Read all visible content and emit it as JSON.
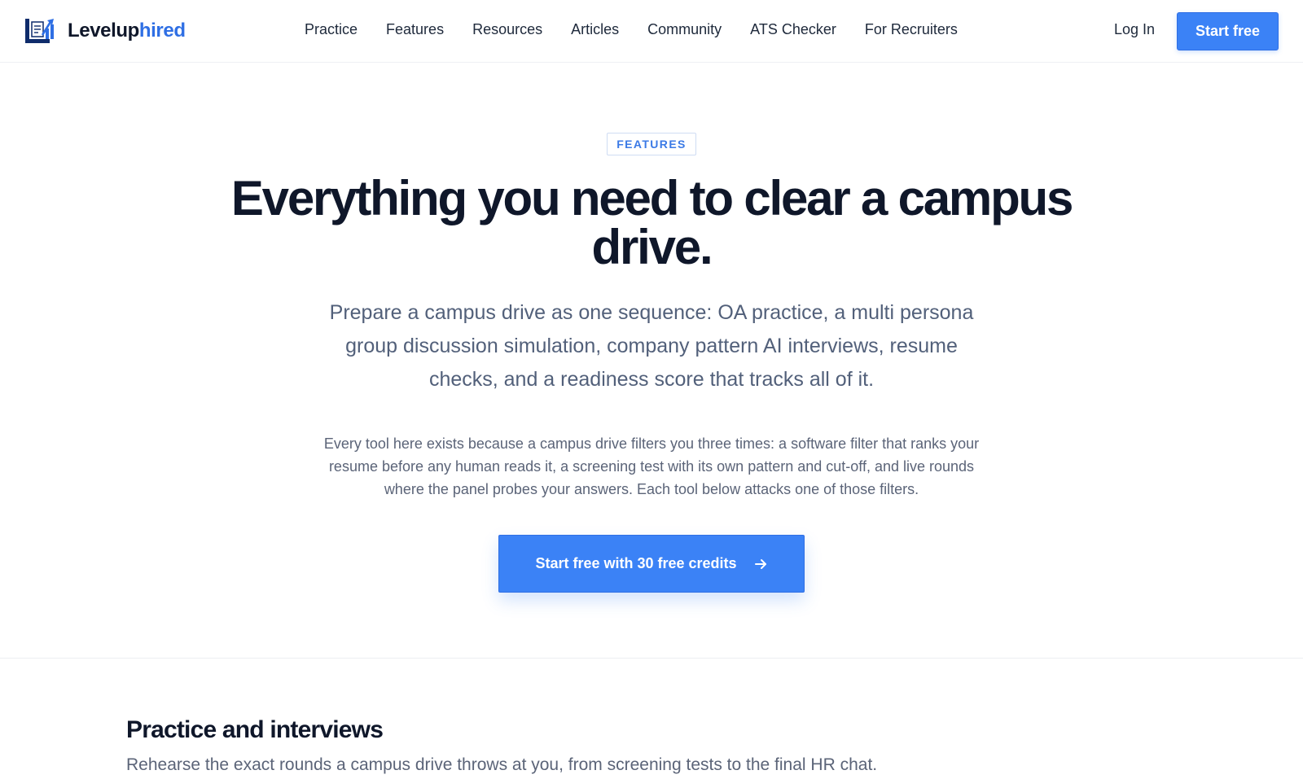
{
  "header": {
    "logo": {
      "name_part1": "Levelup",
      "name_part2": "hired",
      "icon": "chart-document-logo-icon"
    },
    "nav": [
      {
        "label": "Practice"
      },
      {
        "label": "Features"
      },
      {
        "label": "Resources"
      },
      {
        "label": "Articles"
      },
      {
        "label": "Community"
      },
      {
        "label": "ATS Checker"
      },
      {
        "label": "For Recruiters"
      }
    ],
    "login_label": "Log In",
    "start_label": "Start free"
  },
  "hero": {
    "badge": "FEATURES",
    "title_line1": "Everything you need to clear a campus",
    "title_line2": "drive.",
    "subtitle_line1": "Prepare a campus drive as one sequence: OA practice, a multi persona",
    "subtitle_line2": "group discussion simulation, company pattern AI interviews, resume",
    "subtitle_line3": "checks, and a readiness score that tracks all of it.",
    "body_line1": "Every tool here exists because a campus drive filters you three times: a software filter that ranks your",
    "body_line2": "resume before any human reads it, a screening test with its own pattern and cut-off, and live rounds",
    "body_line3": "where the panel probes your answers. Each tool below attacks one of those filters.",
    "cta_label": "Start free with 30 free credits",
    "cta_icon": "arrow-right-icon"
  },
  "section": {
    "title": "Practice and interviews",
    "subtitle": "Rehearse the exact rounds a campus drive throws at you, from screening tests to the final HR chat."
  },
  "colors": {
    "accent": "#3b82f6",
    "brand_dark": "#0f172a",
    "brand_blue": "#2f6fe4",
    "muted_text": "#52607a"
  }
}
